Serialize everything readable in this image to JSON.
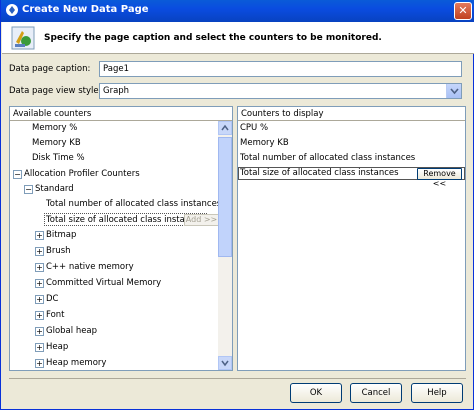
{
  "window": {
    "title": "Create New Data Page",
    "close_glyph": "✕"
  },
  "header": {
    "instruction": "Specify the page caption and select the counters to be monitored."
  },
  "form": {
    "caption_label": "Data page caption:",
    "caption_value": "Page1",
    "view_style_label": "Data page view style:",
    "view_style_value": "Graph"
  },
  "available": {
    "header": "Available counters",
    "items": [
      {
        "label": "Memory %"
      },
      {
        "label": "Memory KB"
      },
      {
        "label": "Disk Time %"
      },
      {
        "label": "Allocation Profiler Counters",
        "expander": "⊟"
      },
      {
        "label": "Standard",
        "expander": "⊟"
      },
      {
        "label": "Total number of allocated class instances"
      },
      {
        "label": "Total size of allocated class instances"
      },
      {
        "label": "Bitmap",
        "expander": "+"
      },
      {
        "label": "Brush",
        "expander": "+"
      },
      {
        "label": "C++ native memory",
        "expander": "+"
      },
      {
        "label": "Committed Virtual Memory",
        "expander": "+"
      },
      {
        "label": "DC",
        "expander": "+"
      },
      {
        "label": "Font",
        "expander": "+"
      },
      {
        "label": "Global heap",
        "expander": "+"
      },
      {
        "label": "Heap",
        "expander": "+"
      },
      {
        "label": "Heap memory",
        "expander": "+"
      }
    ],
    "add_button": "Add >>"
  },
  "display": {
    "header": "Counters to display",
    "items": [
      {
        "label": "CPU %"
      },
      {
        "label": "Memory KB"
      },
      {
        "label": "Total number of allocated class instances"
      },
      {
        "label": "Total size of allocated class instances"
      }
    ],
    "remove_button": "Remove <<"
  },
  "footer": {
    "ok": "OK",
    "cancel": "Cancel",
    "help": "Help"
  },
  "colors": {
    "titlebar": "#0a4ce0",
    "dialog_bg": "#ece9d8",
    "border": "#7f9db9"
  }
}
